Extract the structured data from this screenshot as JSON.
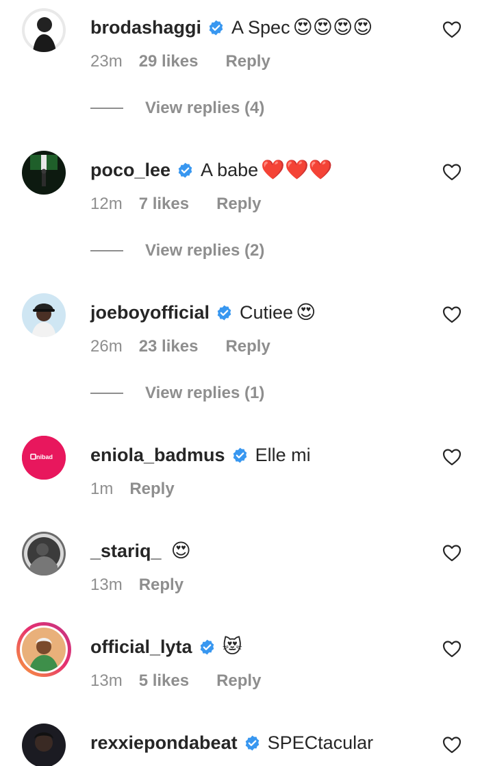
{
  "comments": [
    {
      "username": "brodashaggi",
      "verified": true,
      "text": "A Spec",
      "emoji": "😍😍😍😍",
      "time": "23m",
      "likes": "29 likes",
      "reply": "Reply",
      "view_replies": "View replies (4)",
      "avatar": "dark-portrait"
    },
    {
      "username": "poco_lee",
      "verified": true,
      "text": "A babe",
      "emoji": "❤️❤️❤️",
      "time": "12m",
      "likes": "7 likes",
      "reply": "Reply",
      "view_replies": "View replies (2)",
      "avatar": "green-flag-portrait"
    },
    {
      "username": "joeboyofficial",
      "verified": true,
      "text": "Cutiee",
      "emoji": "😍",
      "time": "26m",
      "likes": "23 likes",
      "reply": "Reply",
      "view_replies": "View replies (1)",
      "avatar": "cap-portrait"
    },
    {
      "username": "eniola_badmus",
      "verified": true,
      "text": "Elle mi",
      "emoji": "",
      "time": "1m",
      "likes": "",
      "reply": "Reply",
      "avatar": "pink-logo",
      "avatar_logo_text": "nibad"
    },
    {
      "username": "_stariq_",
      "verified": false,
      "text": "",
      "emoji": "😍",
      "time": "13m",
      "likes": "",
      "reply": "Reply",
      "avatar": "grayscale-portrait"
    },
    {
      "username": "official_lyta",
      "verified": true,
      "text": "",
      "emoji": "😻",
      "time": "13m",
      "likes": "5 likes",
      "reply": "Reply",
      "avatar": "story-ring-portrait"
    },
    {
      "username": "rexxiepondabeat",
      "verified": true,
      "text": "SPECtacular",
      "emoji": "",
      "avatar": "dark-portrait"
    }
  ],
  "icons": {
    "verified": "verified-badge-icon",
    "like": "heart-outline-icon"
  },
  "colors": {
    "verified": "#3897f0",
    "secondary_text": "#8e8e8e",
    "primary_text": "#262626",
    "story_ring": "#e6306f",
    "eniola_avatar": "#e8175d"
  }
}
